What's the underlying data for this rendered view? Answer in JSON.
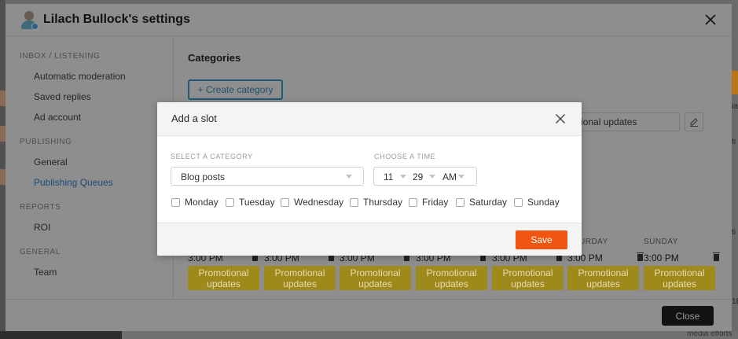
{
  "settings": {
    "title": "Lilach Bullock's settings",
    "sidebar": {
      "sections": [
        {
          "label": "INBOX / LISTENING",
          "items": [
            "Automatic moderation",
            "Saved replies",
            "Ad account"
          ]
        },
        {
          "label": "PUBLISHING",
          "items": [
            "General",
            "Publishing Queues"
          ]
        },
        {
          "label": "REPORTS",
          "items": [
            "ROI"
          ]
        },
        {
          "label": "GENERAL",
          "items": [
            "Team"
          ]
        }
      ],
      "active_item": "Publishing Queues"
    },
    "main": {
      "title": "Categories",
      "create_button": "+ Create category",
      "category_input_value": "otional updates",
      "day_headers": [
        "URDAY",
        "SUNDAY"
      ],
      "queue": [
        {
          "time": "3:00 PM",
          "chip": "Promotional updates"
        },
        {
          "time": "3:00 PM",
          "chip": "Promotional updates"
        },
        {
          "time": "3:00 PM",
          "chip": "Promotional updates"
        },
        {
          "time": "3:00 PM",
          "chip": "Promotional updates"
        },
        {
          "time": "3:00 PM",
          "chip": "Promotional updates"
        },
        {
          "time": "3:00 PM",
          "chip": "Promotional updates"
        },
        {
          "time": "3:00 PM",
          "chip": "Promotional updates"
        }
      ]
    },
    "close_button": "Close"
  },
  "dialog": {
    "title": "Add a slot",
    "category_label": "SELECT A CATEGORY",
    "category_value": "Blog posts",
    "time_label": "CHOOSE A TIME",
    "hour": "11",
    "minute": "29",
    "ampm": "AM",
    "days": [
      "Monday",
      "Tuesday",
      "Wednesday",
      "Thursday",
      "Friday",
      "Saturday",
      "Sunday"
    ],
    "save_button": "Save"
  },
  "background": {
    "right_snippets": [
      "ia",
      "ti",
      "ti",
      "18"
    ],
    "bottom_snippet": "media efforts"
  },
  "colors": {
    "accent_orange": "#f25511",
    "link_blue": "#1b6fb4",
    "chip_yellow": "#e9c21f",
    "close_button_dark": "#121212"
  }
}
